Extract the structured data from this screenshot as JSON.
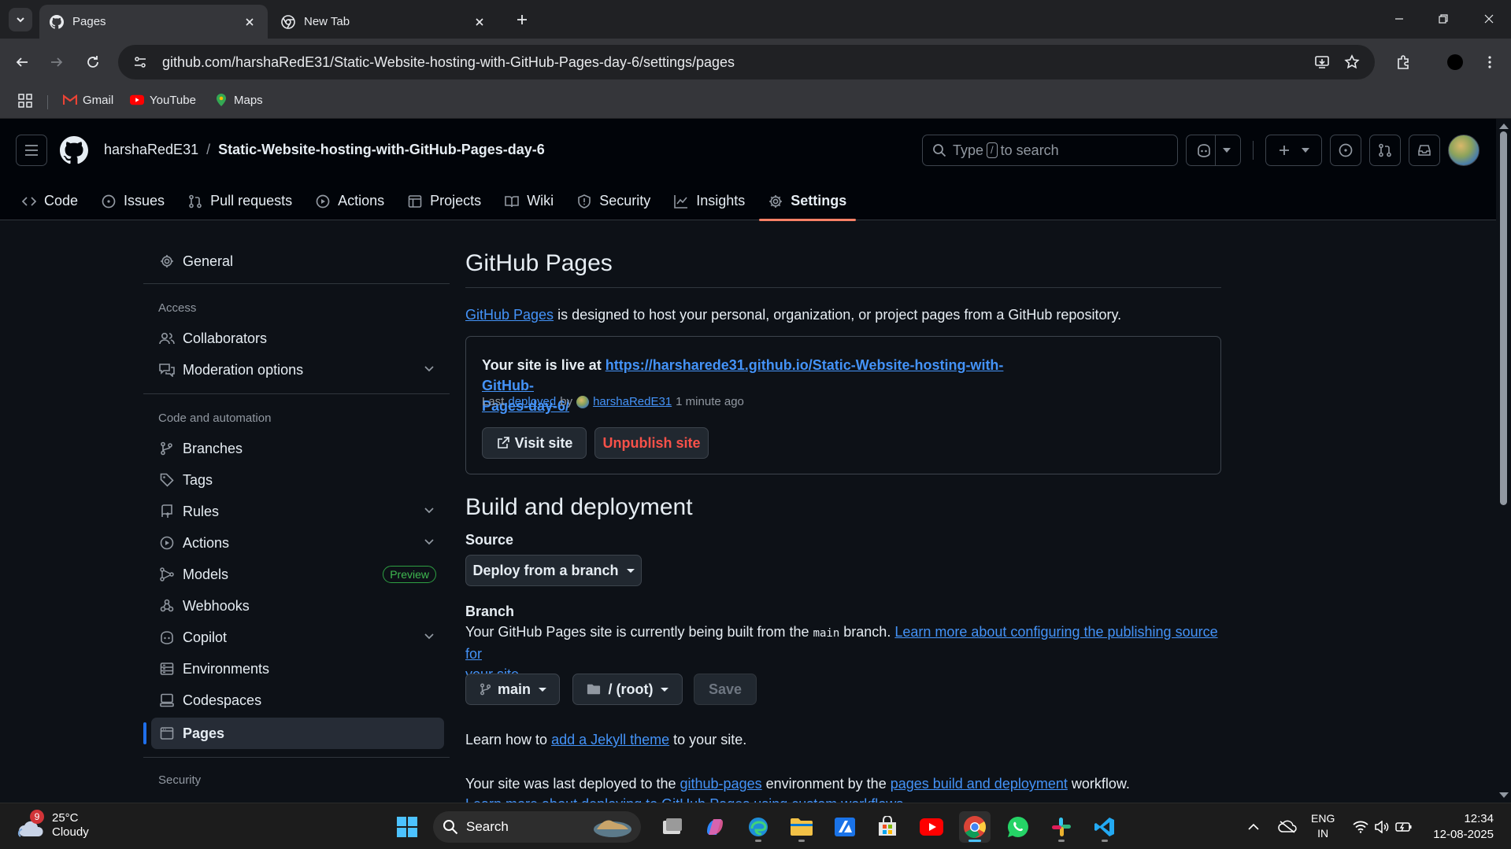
{
  "browser": {
    "tabs": [
      {
        "title": "Pages",
        "favicon": "github-icon",
        "active": true
      },
      {
        "title": "New Tab",
        "favicon": "chrome-icon",
        "active": false
      }
    ],
    "url": "github.com/harshaRedE31/Static-Website-hosting-with-GitHub-Pages-day-6/settings/pages",
    "bookmarks": [
      {
        "label": "Gmail",
        "icon": "gmail-icon"
      },
      {
        "label": "YouTube",
        "icon": "youtube-icon"
      },
      {
        "label": "Maps",
        "icon": "maps-icon"
      }
    ]
  },
  "github": {
    "owner": "harshaRedE31",
    "separator": "/",
    "repo": "Static-Website-hosting-with-GitHub-Pages-day-6",
    "search": {
      "prefix": "Type",
      "key": "/",
      "suffix": "to search"
    },
    "repo_nav": [
      {
        "label": "Code",
        "icon": "code-icon"
      },
      {
        "label": "Issues",
        "icon": "issue-icon"
      },
      {
        "label": "Pull requests",
        "icon": "pull-request-icon"
      },
      {
        "label": "Actions",
        "icon": "play-icon"
      },
      {
        "label": "Projects",
        "icon": "table-icon"
      },
      {
        "label": "Wiki",
        "icon": "book-icon"
      },
      {
        "label": "Security",
        "icon": "shield-icon"
      },
      {
        "label": "Insights",
        "icon": "graph-icon"
      },
      {
        "label": "Settings",
        "icon": "gear-icon",
        "selected": true
      }
    ]
  },
  "sidebar": {
    "general": "General",
    "access_heading": "Access",
    "collaborators": "Collaborators",
    "moderation": "Moderation options",
    "code_heading": "Code and automation",
    "branches": "Branches",
    "tags": "Tags",
    "rules": "Rules",
    "actions": "Actions",
    "models": "Models",
    "models_badge": "Preview",
    "webhooks": "Webhooks",
    "copilot": "Copilot",
    "environments": "Environments",
    "codespaces": "Codespaces",
    "pages": "Pages",
    "security_heading": "Security"
  },
  "main": {
    "title": "GitHub Pages",
    "intro_link": "GitHub Pages",
    "intro_text": " is designed to host your personal, organization, or project pages from a GitHub repository.",
    "live_prefix": "Your site is live at ",
    "live_url_1": "https://harsharede31.github.io/Static-Website-hosting-with-GitHub-",
    "live_url_2": "Pages-day-6/",
    "meta_last": "Last",
    "meta_deployed": "deployed",
    "meta_by": "by",
    "meta_user": "harshaRedE31",
    "meta_time": "1 minute ago",
    "visit_site": "Visit site",
    "unpublish_site": "Unpublish site",
    "build_title": "Build and deployment",
    "source_label": "Source",
    "source_value": "Deploy from a branch",
    "branch_label": "Branch",
    "branch_text_1": "Your GitHub Pages site is currently being built from the ",
    "branch_code": "main",
    "branch_text_2": " branch. ",
    "branch_link_1": "Learn more about configuring the publishing source for",
    "branch_link_2": "your site",
    "branch_text_3": ".",
    "branch_select": "main",
    "folder_select": "/ (root)",
    "save": "Save",
    "jekyll_1": "Learn how to ",
    "jekyll_link": "add a Jekyll theme",
    "jekyll_2": " to your site.",
    "deployed_1": "Your site was last deployed to the ",
    "deployed_link_1": "github-pages",
    "deployed_2": " environment by the ",
    "deployed_link_2": "pages build and deployment",
    "deployed_3": " workflow.",
    "cutoff_link": "Learn more about deploying to GitHub Pages using custom workflows"
  },
  "taskbar": {
    "weather_badge": "9",
    "temperature": "25°C",
    "condition": "Cloudy",
    "search": "Search",
    "lang_1": "ENG",
    "lang_2": "IN",
    "time": "12:34",
    "date": "12-08-2025"
  },
  "colors": {
    "accent_link": "#4493f8",
    "nav_underline": "#f78166",
    "danger": "#f85149",
    "preview_badge": "#3fb950"
  }
}
